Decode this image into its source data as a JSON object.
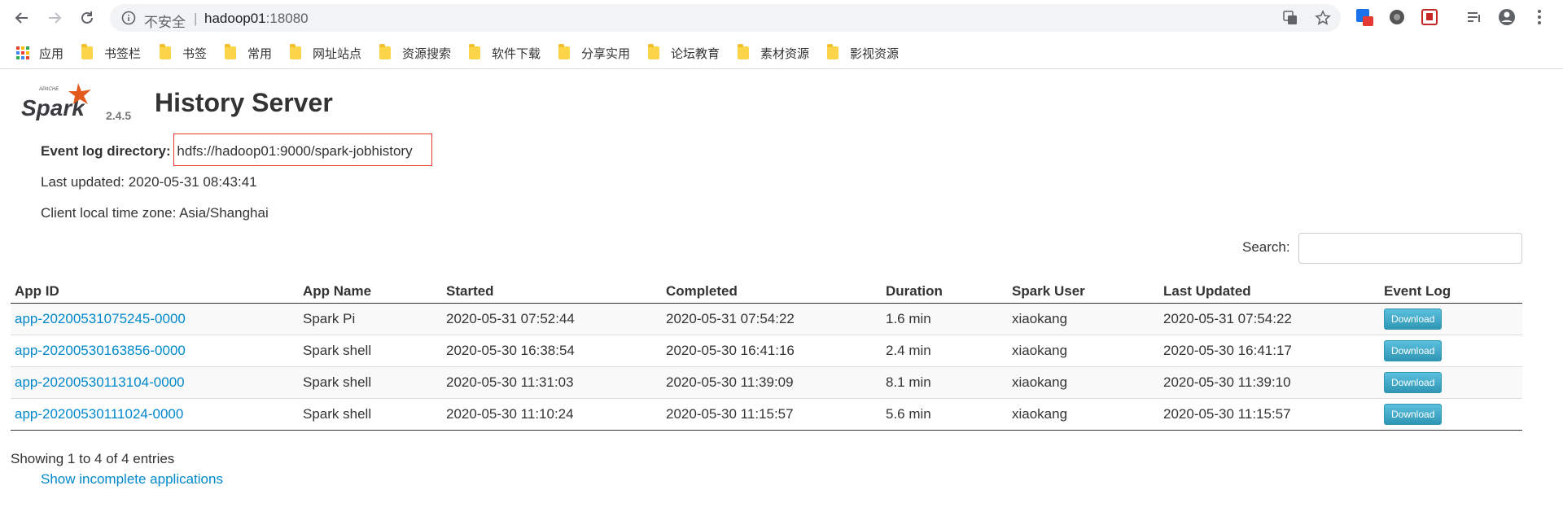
{
  "browser": {
    "insecure_label": "不安全",
    "separator": "|",
    "url_host": "hadoop01",
    "url_port": ":18080"
  },
  "bookmarks": {
    "apps_label": "应用",
    "items": [
      "书签栏",
      "书签",
      "常用",
      "网址站点",
      "资源搜索",
      "软件下载",
      "分享实用",
      "论坛教育",
      "素材资源",
      "影视资源"
    ]
  },
  "header": {
    "logo_text": "Spark",
    "logo_subtext": "APACHE",
    "version": "2.4.5",
    "title": "History Server"
  },
  "info": {
    "event_log_label": "Event log directory:",
    "event_log_value": "hdfs://hadoop01:9000/spark-jobhistory",
    "last_updated": "Last updated: 2020-05-31 08:43:41",
    "timezone": "Client local time zone: Asia/Shanghai"
  },
  "search": {
    "label": "Search:",
    "value": ""
  },
  "table": {
    "headers": [
      "App ID",
      "App Name",
      "Started",
      "Completed",
      "Duration",
      "Spark User",
      "Last Updated",
      "Event Log"
    ],
    "rows": [
      {
        "app_id": "app-20200531075245-0000",
        "app_name": "Spark Pi",
        "started": "2020-05-31 07:52:44",
        "completed": "2020-05-31 07:54:22",
        "duration": "1.6 min",
        "user": "xiaokang",
        "last_updated": "2020-05-31 07:54:22",
        "event_log": "Download"
      },
      {
        "app_id": "app-20200530163856-0000",
        "app_name": "Spark shell",
        "started": "2020-05-30 16:38:54",
        "completed": "2020-05-30 16:41:16",
        "duration": "2.4 min",
        "user": "xiaokang",
        "last_updated": "2020-05-30 16:41:17",
        "event_log": "Download"
      },
      {
        "app_id": "app-20200530113104-0000",
        "app_name": "Spark shell",
        "started": "2020-05-30 11:31:03",
        "completed": "2020-05-30 11:39:09",
        "duration": "8.1 min",
        "user": "xiaokang",
        "last_updated": "2020-05-30 11:39:10",
        "event_log": "Download"
      },
      {
        "app_id": "app-20200530111024-0000",
        "app_name": "Spark shell",
        "started": "2020-05-30 11:10:24",
        "completed": "2020-05-30 11:15:57",
        "duration": "5.6 min",
        "user": "xiaokang",
        "last_updated": "2020-05-30 11:15:57",
        "event_log": "Download"
      }
    ]
  },
  "footer": {
    "entries": "Showing 1 to 4 of 4 entries",
    "incomplete_link": "Show incomplete applications"
  },
  "colors": {
    "link": "#0088cc",
    "highlight_border": "#e53935",
    "download_button": "#49afcd",
    "spark_orange": "#e25a1c"
  }
}
